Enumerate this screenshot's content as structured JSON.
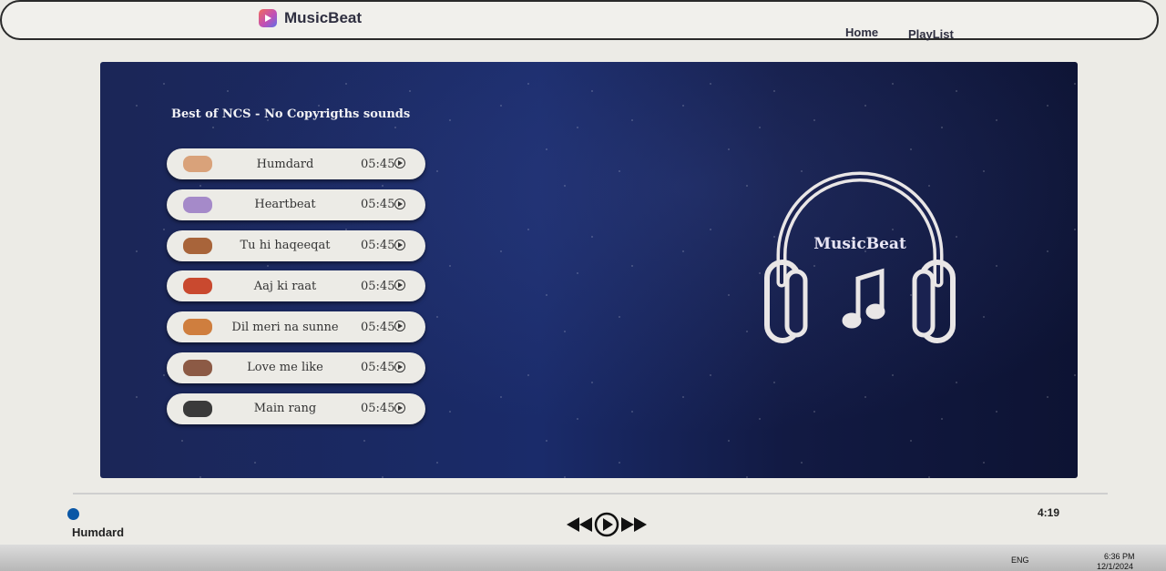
{
  "brand": {
    "name": "MusicBeat"
  },
  "nav": {
    "home": "Home",
    "playlist": "PlayList"
  },
  "playlist": {
    "title": "Best of NCS - No Copyrigths sounds",
    "tracks": [
      {
        "name": "Humdard",
        "duration": "05:45",
        "thumb_color": "#d9a27a"
      },
      {
        "name": "Heartbeat",
        "duration": "05:45",
        "thumb_color": "#a58ac9"
      },
      {
        "name": "Tu hi haqeeqat",
        "duration": "05:45",
        "thumb_color": "#a8643a"
      },
      {
        "name": "Aaj ki raat",
        "duration": "05:45",
        "thumb_color": "#c9492f"
      },
      {
        "name": "Dil meri na sunne",
        "duration": "05:45",
        "thumb_color": "#cf7e3e"
      },
      {
        "name": "Love me like",
        "duration": "05:45",
        "thumb_color": "#8c5a45"
      },
      {
        "name": "Main rang",
        "duration": "05:45",
        "thumb_color": "#3a3a3a"
      }
    ]
  },
  "art": {
    "label": "MusicBeat"
  },
  "player": {
    "now_playing": "Humdard",
    "time": "4:19",
    "progress": 0.0
  },
  "taskbar": {
    "lang": "ENG",
    "time": "6:36 PM",
    "date": "12/1/2024"
  },
  "colors": {
    "panel_bg": "#1a2b6a",
    "accent": "#0a57a6"
  }
}
